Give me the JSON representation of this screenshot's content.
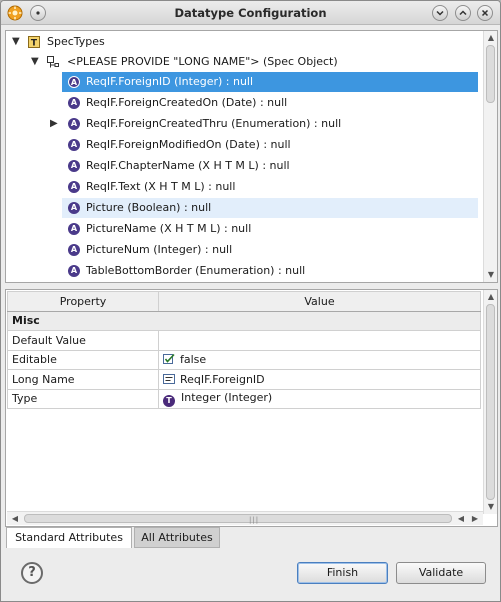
{
  "window": {
    "title": "Datatype Configuration"
  },
  "tree": {
    "root_label": "SpecTypes",
    "spec_object_label": "<PLEASE PROVIDE \"LONG NAME\"> (Spec Object)",
    "items": [
      {
        "label": "ReqIF.ForeignID (Integer) : null",
        "state": "selected",
        "expandable": false
      },
      {
        "label": "ReqIF.ForeignCreatedOn (Date) : null",
        "state": "normal",
        "expandable": false
      },
      {
        "label": "ReqIF.ForeignCreatedThru (Enumeration) : null",
        "state": "normal",
        "expandable": true
      },
      {
        "label": "ReqIF.ForeignModifiedOn (Date) : null",
        "state": "normal",
        "expandable": false
      },
      {
        "label": "ReqIF.ChapterName (X H T M L) : null",
        "state": "normal",
        "expandable": false
      },
      {
        "label": "ReqIF.Text (X H T M L) : null",
        "state": "normal",
        "expandable": false
      },
      {
        "label": "Picture (Boolean) : null",
        "state": "hover",
        "expandable": false
      },
      {
        "label": "PictureName (X H T M L) : null",
        "state": "normal",
        "expandable": false
      },
      {
        "label": "PictureNum (Integer) : null",
        "state": "normal",
        "expandable": false
      },
      {
        "label": "TableBottomBorder (Enumeration) : null",
        "state": "normal",
        "expandable": false
      }
    ],
    "attr_icon_letter": "A"
  },
  "properties": {
    "col_property": "Property",
    "col_value": "Value",
    "category": "Misc",
    "rows": [
      {
        "property": "Default Value",
        "value": "",
        "icon": ""
      },
      {
        "property": "Editable",
        "value": "false",
        "icon": "checkbox-icon"
      },
      {
        "property": "Long Name",
        "value": "ReqIF.ForeignID",
        "icon": "text-field-icon"
      },
      {
        "property": "Type",
        "value": "Integer (Integer)",
        "icon": "type-icon"
      }
    ],
    "type_icon_letter": "T"
  },
  "tabs": [
    {
      "label": "Standard Attributes",
      "active": true
    },
    {
      "label": "All Attributes",
      "active": false
    }
  ],
  "buttons": {
    "finish": "Finish",
    "validate": "Validate"
  },
  "colors": {
    "selection": "#3d96e0",
    "hover": "#e2eefb",
    "attr_icon": "#4a3a8a"
  }
}
